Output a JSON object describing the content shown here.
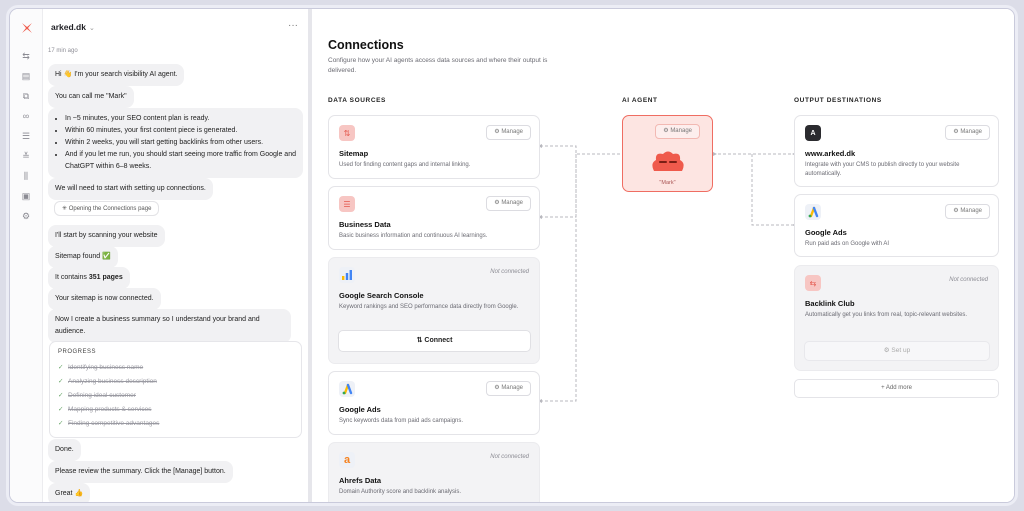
{
  "workspace": {
    "name": "arked.dk",
    "caret": "⌄",
    "more": "···"
  },
  "chat": {
    "time": "17 min ago",
    "messages": [
      {
        "text": "Hi 👋 I'm your search visibility AI agent."
      },
      {
        "text": "You can call me \"Mark\""
      },
      {
        "bullets": [
          "In ~5 minutes, your SEO content plan is ready.",
          "Within 60 minutes, your first content piece is generated.",
          "Within 2 weeks, you will start getting backlinks from other users.",
          "And if you let me run, you should start seeing more traffic from Google and ChatGPT within 6–8 weeks."
        ]
      },
      {
        "text": "We will need to start with setting up connections."
      },
      {
        "text": "I'll start by scanning your website"
      },
      {
        "text": "Sitemap found ✅"
      },
      {
        "pre": "It contains ",
        "bold": "351 pages"
      },
      {
        "text": "Your sitemap is now connected."
      },
      {
        "text": "Now I create a business summary so I understand your brand and audience."
      },
      {
        "text": "Done."
      },
      {
        "text": "Please review the summary. Click the [Manage] button."
      },
      {
        "text": "Great 👍"
      }
    ],
    "action_pill": "Opening the Connections page",
    "progress": {
      "title": "PROGRESS",
      "steps": [
        "Identifying business name",
        "Analyzing business description",
        "Defining ideal customer",
        "Mapping products & services",
        "Finding competitive advantages"
      ]
    }
  },
  "page": {
    "title": "Connections",
    "subtitle": "Configure how your AI agents access data sources and where their output is delivered."
  },
  "columns": {
    "sources": "DATA SOURCES",
    "agent": "AI AGENT",
    "outputs": "OUTPUT DESTINATIONS"
  },
  "labels": {
    "manage": "Manage",
    "not_connected": "Not connected",
    "connect": "Connect",
    "setup": "Set up",
    "add_more": "+ Add more"
  },
  "sources": [
    {
      "name": "Sitemap",
      "desc": "Used for finding content gaps and internal linking.",
      "status": "manage",
      "icon": "sitemap-icon"
    },
    {
      "name": "Business Data",
      "desc": "Basic business information and continuous AI learnings.",
      "status": "manage",
      "icon": "database-icon"
    },
    {
      "name": "Google Search Console",
      "desc": "Keyword rankings and SEO performance data directly from Google.",
      "status": "not_connected",
      "icon": "search-console-icon"
    },
    {
      "name": "Google Ads",
      "desc": "Sync keywords data from paid ads campaigns.",
      "status": "manage",
      "icon": "google-ads-icon"
    },
    {
      "name": "Ahrefs Data",
      "desc": "Domain Authority score and backlink analysis.",
      "status": "not_connected",
      "icon": "ahrefs-icon"
    }
  ],
  "agent": {
    "name": "\"Mark\""
  },
  "outputs": [
    {
      "name": "www.arked.dk",
      "desc": "Integrate with your CMS to publish directly to your website automatically.",
      "status": "manage",
      "icon": "website-icon"
    },
    {
      "name": "Google Ads",
      "desc": "Run paid ads on Google with AI",
      "status": "manage",
      "icon": "google-ads-icon"
    },
    {
      "name": "Backlink Club",
      "desc": "Automatically get you links from real, topic-relevant websites.",
      "status": "not_connected",
      "icon": "backlink-icon"
    }
  ],
  "colors": {
    "accent": "#ef5a4c",
    "agent_bg": "#fde5e2"
  }
}
